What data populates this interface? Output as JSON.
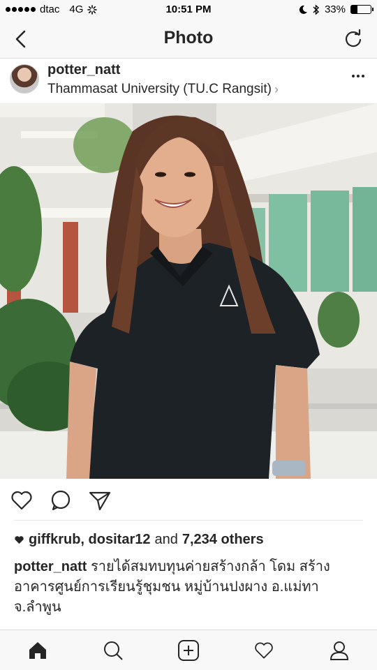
{
  "status_bar": {
    "carrier": "dtac",
    "network": "4G",
    "time": "10:51 PM",
    "battery_percent": "33%",
    "battery_level": 0.33
  },
  "nav": {
    "title": "Photo"
  },
  "post": {
    "username": "potter_natt",
    "location": "Thammasat University (TU.C Rangsit)",
    "likes": {
      "names": "giffkrub, dositar12",
      "connector": "and",
      "others": "7,234 others"
    },
    "caption": {
      "username": "potter_natt",
      "text": "รายได้สมทบทุนค่ายสร้างกล้า โดม สร้างอาคารศูนย์การเรียนรู้ชุมชน หมู่บ้านปงผาง อ.แม่ทา จ.ลำพูน"
    }
  },
  "colors": {
    "text": "#262626",
    "bar_bg": "#f8f8f8",
    "divider": "#dbdbdb"
  },
  "icons": {
    "like": "heart-icon",
    "comment": "comment-icon",
    "share": "send-icon",
    "home": "home-icon",
    "search": "search-icon",
    "add": "add-post-icon",
    "activity": "heart-icon",
    "profile": "profile-icon"
  }
}
